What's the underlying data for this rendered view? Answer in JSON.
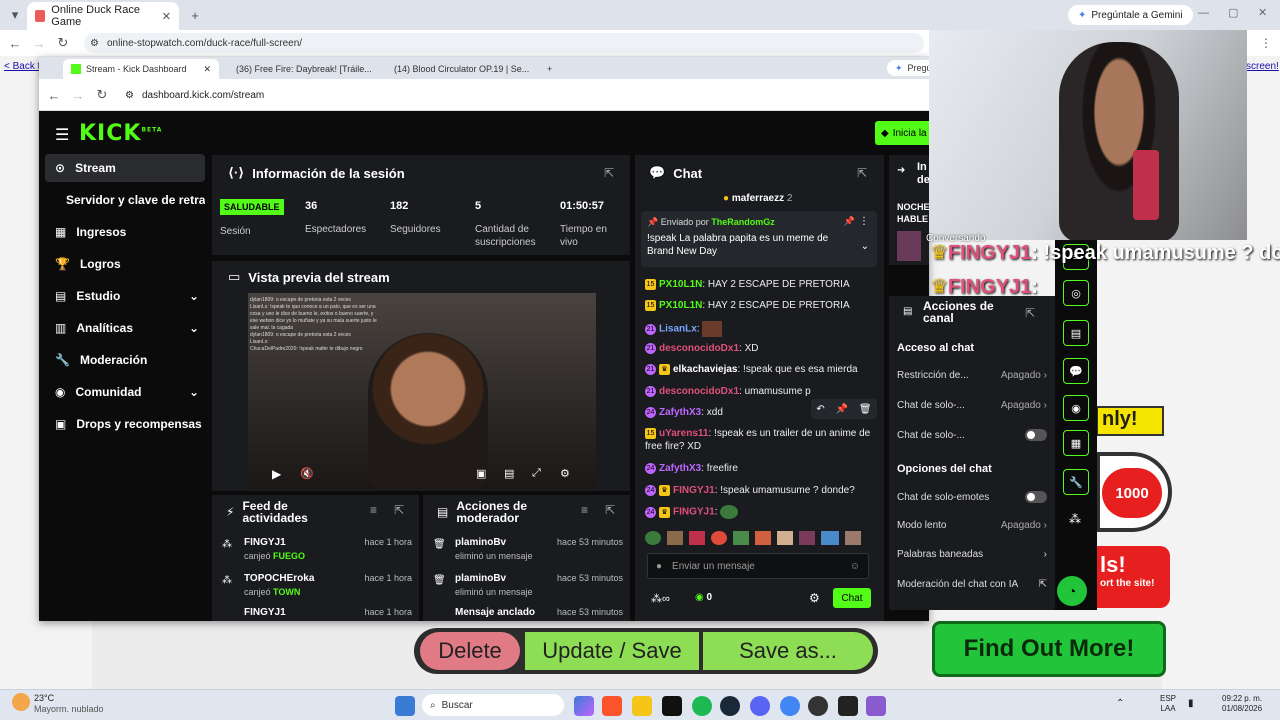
{
  "outer": {
    "tab_title": "Online Duck Race Game",
    "url": "online-stopwatch.com/duck-race/full-screen/",
    "gemini": "Pregúntale a Gemini",
    "back_link": "< Back to",
    "right_link": "screen!"
  },
  "inner": {
    "tabs": [
      "Stream - Kick Dashboard",
      "(36) Free Fire: Daybreak! [Tráile...",
      "(14) Blood Circulator OP.19 | Se..."
    ],
    "gemini": "Pregú",
    "url": "dashboard.kick.com/stream"
  },
  "kick": {
    "logo": "KICK",
    "logo_sup": "BETA",
    "cta": "Inicia la",
    "sidebar": [
      {
        "label": "Stream"
      },
      {
        "label": "Servidor y clave de retransm"
      },
      {
        "label": "Ingresos"
      },
      {
        "label": "Logros"
      },
      {
        "label": "Estudio"
      },
      {
        "label": "Analíticas"
      },
      {
        "label": "Moderación"
      },
      {
        "label": "Comunidad"
      },
      {
        "label": "Drops y recompensas"
      }
    ],
    "session": {
      "title": "Información de la sesión",
      "badge": "SALUDABLE",
      "badge_label": "Sesión",
      "stats": [
        {
          "value": "36",
          "label": "Espectadores"
        },
        {
          "value": "182",
          "label": "Seguidores"
        },
        {
          "value": "5",
          "label": "Cantidad de suscripciones"
        },
        {
          "value": "01:50:57",
          "label": "Tiempo en vivo"
        }
      ]
    },
    "preview": {
      "title": "Vista previa del stream",
      "overlay": [
        "dylan1809: o escape de pretoria esta 2 veces",
        "LisanLx: !speak te quo conoce a un pato, que es ser una",
        "cosa y uno le dice de bueno le, exitos o bueno suerte, y",
        "ese webon dice yo lo muñate y ya su mala suerte justo le",
        "sale mal. la cagada",
        "dylan1809: o escape de pretoria esta 2 veces",
        "LisanLx: ",
        "ChucaDelPadre2020: !speak mafer te dibujo negro"
      ]
    },
    "feed": {
      "title": "Feed de actividades",
      "items": [
        {
          "user": "FINGYJ1",
          "time": "hace 1 hora",
          "action": "canjeó",
          "item": "FUEGO"
        },
        {
          "user": "TOPOCHEroka",
          "time": "hace 1 hora",
          "action": "canjeó",
          "item": "TOWN"
        },
        {
          "user": "FINGYJ1",
          "time": "hace 1 hora"
        }
      ]
    },
    "modactions": {
      "title": "Acciones de moderador",
      "items": [
        {
          "user": "plaminoBv",
          "time": "hace 53 minutos",
          "action": "eliminó un mensaje"
        },
        {
          "user": "plaminoBv",
          "time": "hace 53 minutos",
          "action": "eliminó un mensaje"
        },
        {
          "user": "Mensaje anclado",
          "time": "hace 53 minutos"
        }
      ]
    },
    "chat": {
      "title": "Chat",
      "top_user": "maferraezz",
      "top_count": "2",
      "pinned_by": "Enviado por",
      "pinned_user": "TheRandomGz",
      "pinned_text": "!speak La palabra papita es un meme de Brand New Day",
      "messages": [
        {
          "user": "PX10L1N",
          "text": ": HAY 2 ESCAPE DE PRETORIA"
        },
        {
          "user": "PX10L1N",
          "text": ": HAY 2 ESCAPE DE PRETORIA"
        },
        {
          "user": "LisanLx",
          "text": ":"
        },
        {
          "user": "desconocidoDx1",
          "text": ": XD"
        },
        {
          "user": "elkachaviejas",
          "text": ": !speak que es esa mierda"
        },
        {
          "user": "desconocidoDx1",
          "text": ": umamusume p"
        },
        {
          "user": "ZafythX3",
          "text": ": xdd"
        },
        {
          "user": "uYarens11",
          "text": ": !speak es un trailer de un anime de free fire? XD"
        },
        {
          "user": "ZafythX3",
          "text": ": freefire"
        },
        {
          "user": "FINGYJ1",
          "text": ": !speak umamusume ? donde?"
        },
        {
          "user": "FINGYJ1",
          "text": ":"
        }
      ],
      "input_placeholder": "Enviar un mensaje",
      "count": "0",
      "send": "Chat"
    },
    "partial": {
      "title_a": "In",
      "title_b": "de",
      "l1": "NOCHE",
      "l2": "HABLE",
      "conv": "Conversando"
    },
    "actions": {
      "title": "Acciones de canal",
      "section1": "Acceso al chat",
      "rows1": [
        {
          "label": "Restricción de...",
          "value": "Apagado"
        },
        {
          "label": "Chat de solo-...",
          "value": "Apagado"
        },
        {
          "label": "Chat de solo-...",
          "value": ""
        }
      ],
      "section2": "Opciones del chat",
      "rows2": [
        {
          "label": "Chat de solo-emotes",
          "value": ""
        },
        {
          "label": "Modo lento",
          "value": "Apagado"
        },
        {
          "label": "Palabras baneadas",
          "value": ""
        },
        {
          "label": "Moderación del chat con IA",
          "value": ""
        }
      ]
    }
  },
  "overlay_text": {
    "user": "FINGYJ1",
    "msg": ": !speak umamusume ? donde",
    "user2": "FINGYJ1",
    ":": ":"
  },
  "game": {
    "delete": "Delete",
    "update": "Update / Save",
    "saveas": "Save as...",
    "find": "Find Out More!",
    "num": "1000",
    "lucky": "nly!",
    "ls": "ls!",
    "site": "ort the site!"
  },
  "taskbar": {
    "temp": "23°C",
    "weather": "Mayorm. nublado",
    "search": "Buscar",
    "lang1": "ESP",
    "lang2": "LAA",
    "time": "09:22 p. m.",
    "date": "01/08/2026"
  }
}
